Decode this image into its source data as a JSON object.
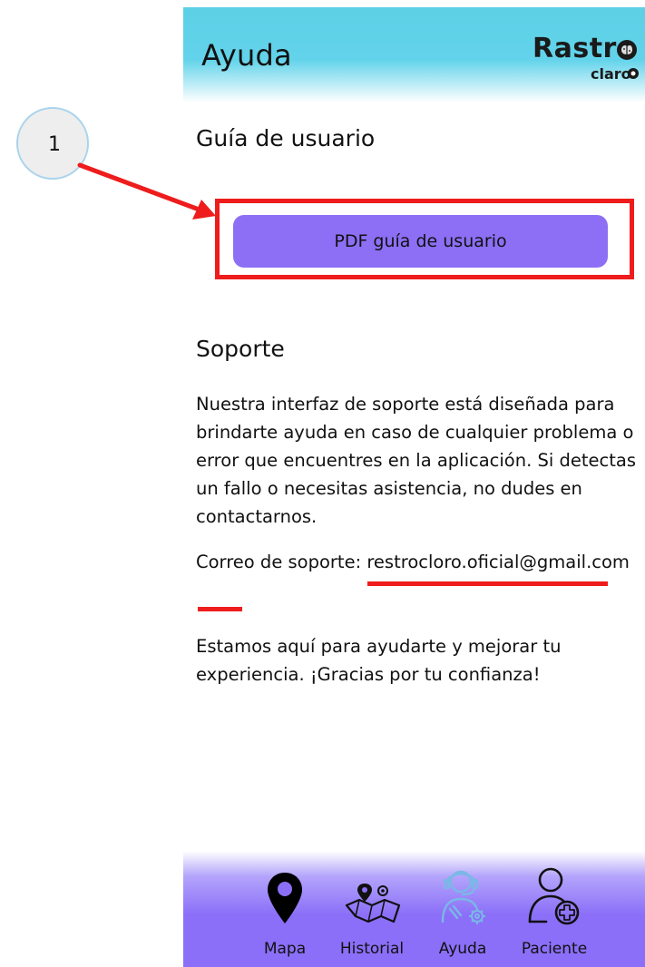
{
  "header": {
    "title": "Ayuda",
    "logo_main": "Rastr",
    "logo_sub": "claro",
    "logo_icon": "brain-pin-icon"
  },
  "guide": {
    "title": "Guía de usuario",
    "pdf_button_label": "PDF guía de usuario"
  },
  "support": {
    "title": "Soporte",
    "description": "Nuestra interfaz de soporte está diseñada para brindarte ayuda en caso de cualquier problema o error que encuentres en la aplicación. Si detectas un fallo o necesitas asistencia, no dudes en contactarnos.",
    "email_label": "Correo de soporte: ",
    "email": "restrocloro.oficial@gmail.com",
    "thanks": "Estamos aquí para ayudarte y mejorar tu experiencia. ¡Gracias por tu confianza!"
  },
  "bottom_nav": {
    "items": [
      {
        "label": "Mapa",
        "icon": "map-pin-icon",
        "active": false
      },
      {
        "label": "Historial",
        "icon": "history-map-icon",
        "active": false
      },
      {
        "label": "Ayuda",
        "icon": "support-agent-icon",
        "active": true
      },
      {
        "label": "Paciente",
        "icon": "add-patient-icon",
        "active": false
      }
    ]
  },
  "annotation": {
    "step_number": "1",
    "color": "#ee1c1c"
  },
  "colors": {
    "header_accent": "#5dd0e6",
    "button_bg": "#8c6ff5",
    "nav_bg": "#8b6ff8",
    "active_icon": "#7ab8e6"
  }
}
